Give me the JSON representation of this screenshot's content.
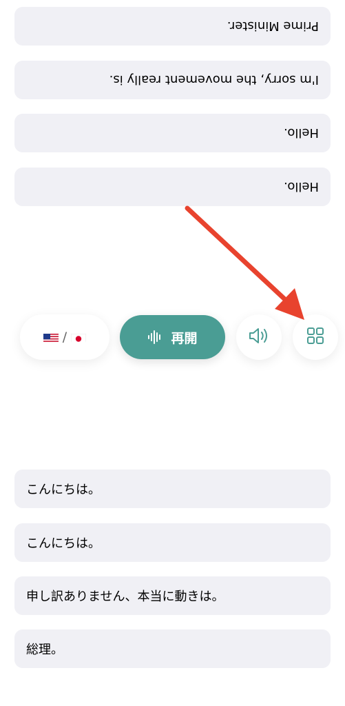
{
  "partner_messages": [
    "Prime Minister.",
    "I'm sorry, the movement really is.",
    "Hello.",
    "Hello."
  ],
  "controls": {
    "languages": {
      "separator": "/",
      "source_flag_icon": "us-flag-icon",
      "target_flag_icon": "japan-flag-icon"
    },
    "resume_label": "再開",
    "resume_icon": "waveform-icon",
    "speaker_icon": "speaker-icon",
    "grid_icon": "grid-icon",
    "accent_color": "#4a9d94"
  },
  "my_messages": [
    "こんにちは。",
    "こんにちは。",
    "申し訳ありません、本当に動きは。",
    "総理。"
  ],
  "annotation": {
    "arrow_color": "#e8432e"
  }
}
